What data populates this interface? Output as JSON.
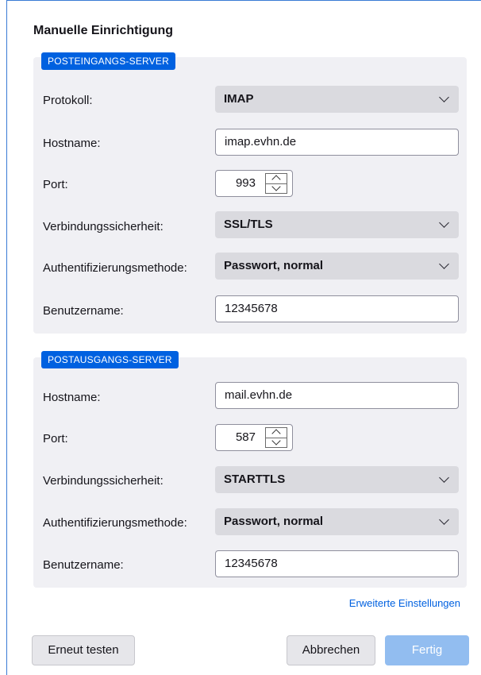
{
  "title": "Manuelle Einrichtigung",
  "incoming": {
    "badge": "POSTEINGANGS-SERVER",
    "protocol_label": "Protokoll:",
    "protocol_value": "IMAP",
    "hostname_label": "Hostname:",
    "hostname_value": "imap.evhn.de",
    "port_label": "Port:",
    "port_value": "993",
    "security_label": "Verbindungssicherheit:",
    "security_value": "SSL/TLS",
    "auth_label": "Authentifizierungsmethode:",
    "auth_value": "Passwort, normal",
    "username_label": "Benutzername:",
    "username_value": "12345678"
  },
  "outgoing": {
    "badge": "POSTAUSGANGS-SERVER",
    "hostname_label": "Hostname:",
    "hostname_value": "mail.evhn.de",
    "port_label": "Port:",
    "port_value": "587",
    "security_label": "Verbindungssicherheit:",
    "security_value": "STARTTLS",
    "auth_label": "Authentifizierungsmethode:",
    "auth_value": "Passwort, normal",
    "username_label": "Benutzername:",
    "username_value": "12345678"
  },
  "advanced_link": "Erweiterte Einstellungen",
  "buttons": {
    "retest": "Erneut testen",
    "cancel": "Abbrechen",
    "done": "Fertig"
  },
  "colors": {
    "accent": "#0061e0",
    "section_bg": "#f0f0f4",
    "done_disabled": "#92bdf0"
  }
}
